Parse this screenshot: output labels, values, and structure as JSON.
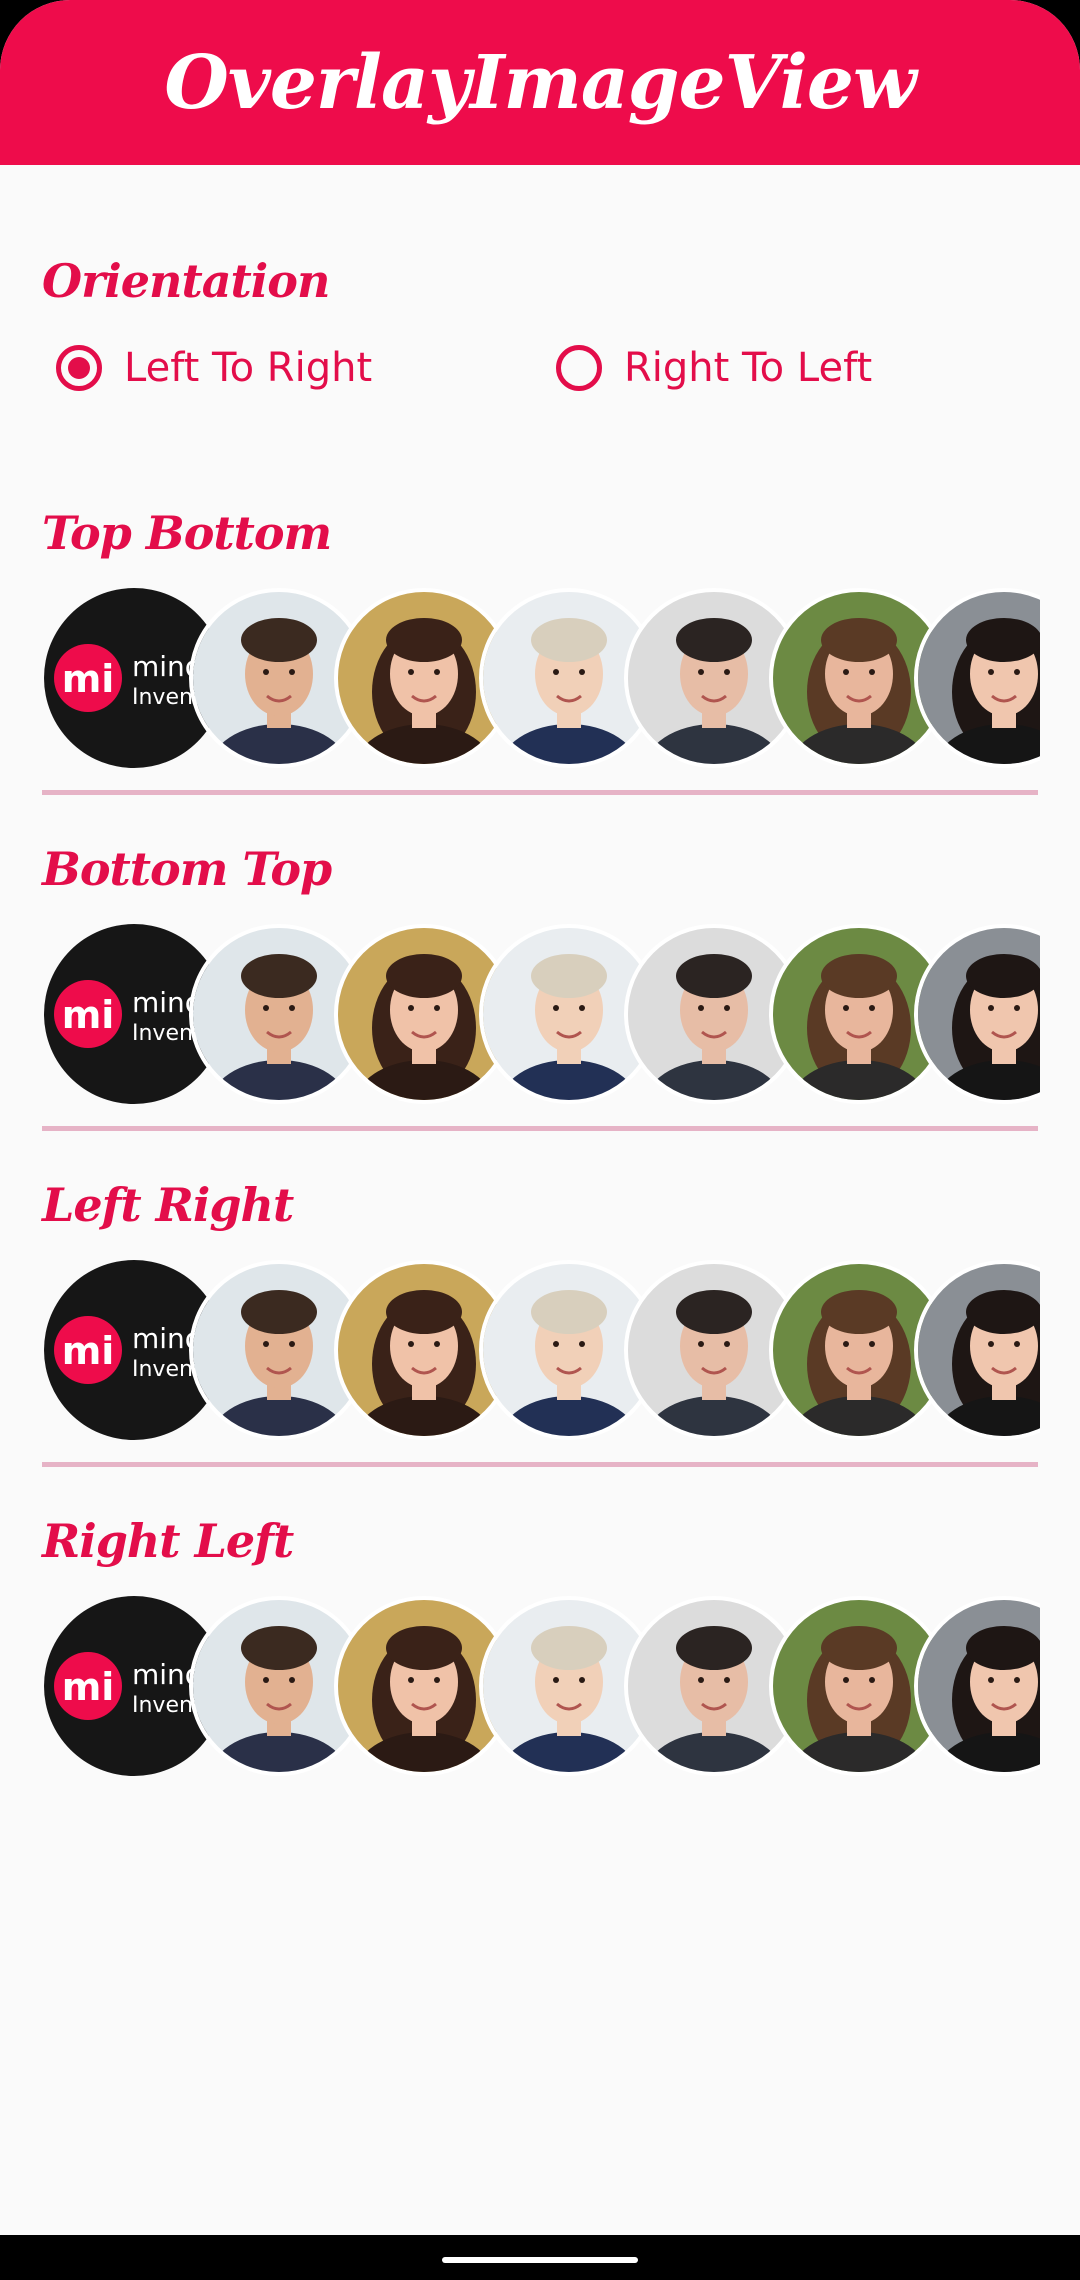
{
  "app": {
    "title": "OverlayImageView"
  },
  "colors": {
    "accent": "#ee0c4b",
    "accent_text": "#e30d4a",
    "divider": "#e6b3c6",
    "background": "#fafafa"
  },
  "orientation": {
    "title": "Orientation",
    "options": [
      {
        "label": "Left To Right",
        "selected": true
      },
      {
        "label": "Right To Left",
        "selected": false
      }
    ]
  },
  "sections": [
    {
      "title": "Top Bottom"
    },
    {
      "title": "Bottom Top"
    },
    {
      "title": "Left Right"
    },
    {
      "title": "Right Left"
    }
  ],
  "avatars": [
    {
      "name": "mindinventory-logo",
      "logo_text_1": "mind",
      "logo_text_2": "Inventory"
    },
    {
      "name": "man-with-beard-avatar"
    },
    {
      "name": "woman-brown-hair-avatar"
    },
    {
      "name": "woman-blonde-short-hair-avatar"
    },
    {
      "name": "man-dark-hair-avatar"
    },
    {
      "name": "woman-curly-hair-avatar"
    },
    {
      "name": "woman-dark-hair-avatar"
    }
  ]
}
